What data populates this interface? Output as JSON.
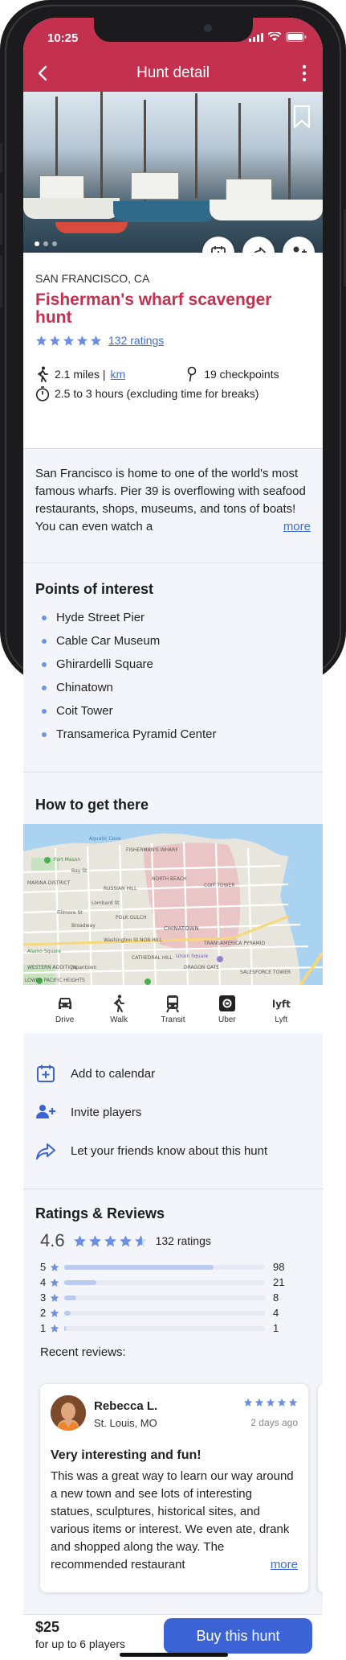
{
  "status_bar": {
    "time": "10:25"
  },
  "nav": {
    "title": "Hunt detail",
    "back": "back-arrow",
    "menu": "more-vertical"
  },
  "hunt": {
    "location": "SAN FRANCISCO, CA",
    "title_line1": "Fisherman's wharf scavenger",
    "title_line2": "hunt",
    "rating": 5,
    "ratings_link": "132 ratings",
    "distance": "2.1 miles |",
    "distance_unit": "km",
    "checkpoints": "19 checkpoints",
    "duration": "2.5 to 3 hours (excluding time for breaks)"
  },
  "description": {
    "text": "San Francisco is home to one of the world's most famous wharfs. Pier 39 is overflowing with seafood restaurants, shops, museums, and tons of boats! You can even watch a",
    "more": "more"
  },
  "points_of_interest": {
    "title": "Points of interest",
    "items": [
      "Hyde Street Pier",
      "Cable Car Museum",
      "Ghirardelli Square",
      "Chinatown",
      "Coit Tower",
      "Transamerica Pyramid Center"
    ]
  },
  "how_to_get_there": {
    "title": "How to get there",
    "map_labels": [
      {
        "text": "Aquatic Cove"
      },
      {
        "text": "Fort Mason"
      },
      {
        "text": "FISHERMAN'S WHARF"
      },
      {
        "text": "NORTH BEACH"
      },
      {
        "text": "COIT TOWER"
      },
      {
        "text": "RUSSIAN HILL"
      },
      {
        "text": "MARINA DISTRICT"
      },
      {
        "text": "Lombard St"
      },
      {
        "text": "Broadway"
      },
      {
        "text": "POLK GULCH"
      },
      {
        "text": "CHINATOWN"
      },
      {
        "text": "NOB HILL"
      },
      {
        "text": "Washington St"
      },
      {
        "text": "TRANSAMERICA PYRAMID"
      },
      {
        "text": "Alamo Square"
      },
      {
        "text": "WESTERN ADDITION"
      },
      {
        "text": "Japantown"
      },
      {
        "text": "Union Square"
      },
      {
        "text": "CATHEDRAL HILL"
      },
      {
        "text": "LOWER PACIFIC HEIGHTS"
      },
      {
        "text": "SALESFORCE TOWER"
      },
      {
        "text": "Fillmore St"
      },
      {
        "text": "Bay St"
      },
      {
        "text": "DRAGON GATE"
      }
    ],
    "transport": [
      "Drive",
      "Walk",
      "Transit",
      "Uber",
      "Lyft"
    ]
  },
  "actions": [
    {
      "label": "Add to calendar",
      "icon": "calendar-plus-icon"
    },
    {
      "label": "Invite players",
      "icon": "users-plus-icon"
    },
    {
      "label": "Let your friends know about this hunt",
      "icon": "share-icon"
    }
  ],
  "ratings": {
    "title": "Ratings & Reviews",
    "average": "4.6",
    "average_stars": 4.6,
    "count": "132 ratings",
    "breakdown": [
      {
        "stars": "5",
        "count": "98",
        "value": 98
      },
      {
        "stars": "4",
        "count": "21",
        "value": 21
      },
      {
        "stars": "3",
        "count": "8",
        "value": 8
      },
      {
        "stars": "2",
        "count": "4",
        "value": 4
      },
      {
        "stars": "1",
        "count": "1",
        "value": 1
      }
    ],
    "recent_label": "Recent reviews:"
  },
  "review": {
    "name": "Rebecca L.",
    "location": "St. Louis, MO",
    "date": "2 days ago",
    "stars": 5,
    "title": "Very interesting and fun!",
    "body": "This was a great way to learn our way around a new town and see lots of interesting statues, sculptures, historical sites, and various items or interest. We even ate, drank and shopped along the way. The recommended restaurant",
    "more": "more"
  },
  "purchase": {
    "price": "$25",
    "price_note": "for up to 6 players",
    "button": "Buy this hunt"
  },
  "colors": {
    "brand": "#c4314f",
    "accent": "#3c63d6",
    "star": "#6c8fe0",
    "link": "#3f6ed8"
  }
}
